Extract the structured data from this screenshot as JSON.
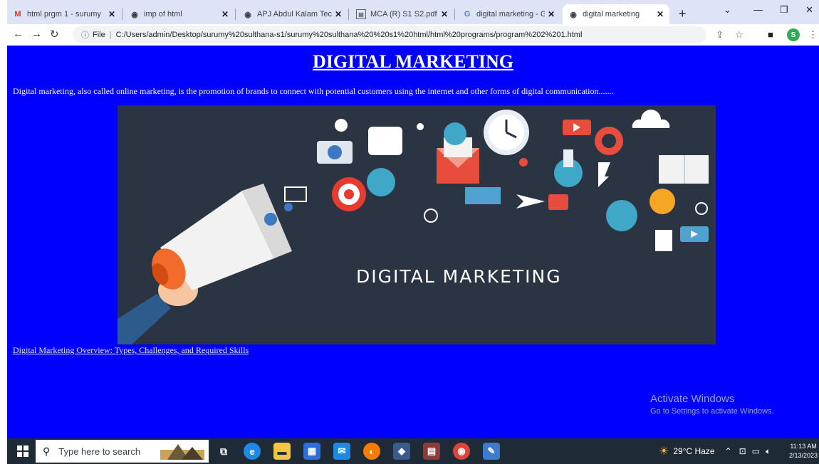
{
  "browser": {
    "tabs": [
      {
        "title": "html prgm 1 - surumy",
        "favicon": "gmail-icon",
        "active": false
      },
      {
        "title": "imp of html",
        "favicon": "globe-icon",
        "active": false
      },
      {
        "title": "APJ Abdul Kalam Tech",
        "favicon": "globe-icon",
        "active": false
      },
      {
        "title": "MCA (R) S1 S2.pdf",
        "favicon": "pdf-icon",
        "active": false
      },
      {
        "title": "digital marketing - Go",
        "favicon": "google-icon",
        "active": false
      },
      {
        "title": "digital marketing",
        "favicon": "globe-icon",
        "active": true
      }
    ],
    "new_tab_label": "+",
    "address": {
      "scheme_label": "File",
      "url": "C:/Users/admin/Desktop/surumy%20sulthana-s1/surumy%20sulthana%20%20s1%20html/html%20programs/program%202%201.html"
    },
    "profile_initial": "S"
  },
  "page": {
    "heading": "DIGITAL MARKETING",
    "intro": "Digital marketing, also called online marketing, is the promotion of brands to connect with potential customers using the internet and other forms of digital communication.......",
    "banner_text": "DIGITAL MARKETING",
    "link_text": "Digital Marketing Overview: Types, Challenges, and Required Skills"
  },
  "watermark": {
    "line1": "Activate Windows",
    "line2": "Go to Settings to activate Windows."
  },
  "taskbar": {
    "search_placeholder": "Type here to search",
    "weather": "29°C Haze",
    "time": "11:13 AM",
    "date": "2/13/2023"
  },
  "colors": {
    "page_background": "#0000ff",
    "banner_background": "#2b3442",
    "tab_strip": "#dfe3f7",
    "taskbar": "#1e2a36"
  }
}
